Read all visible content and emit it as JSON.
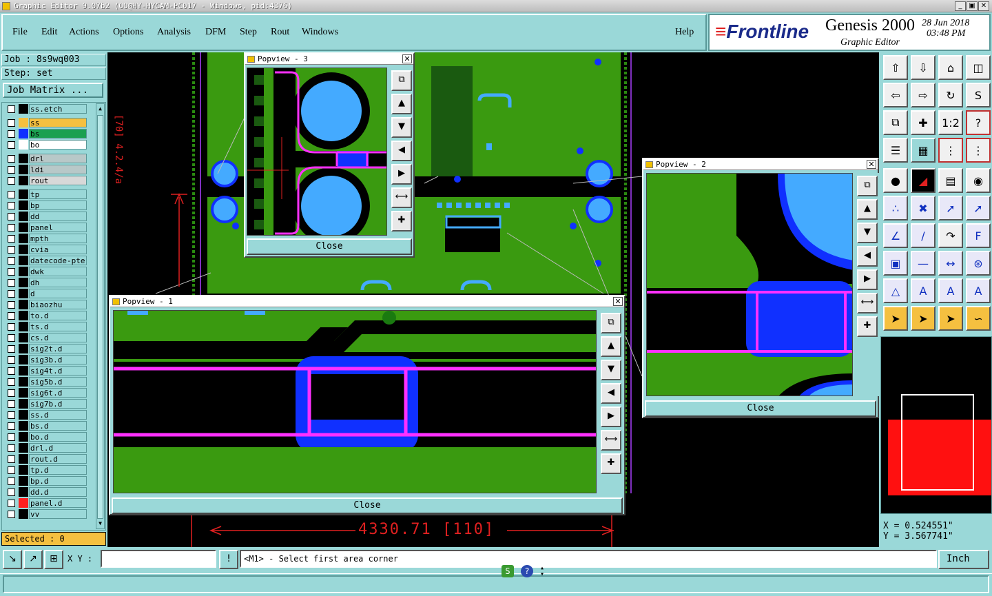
{
  "window": {
    "title": "Graphic Editor 9.07b2 (OO@HY-HYCAM-PC017 - Windows, pid:4376)",
    "min_label": "_",
    "max_label": "▣",
    "close_label": "✕"
  },
  "menu": {
    "items": [
      "File",
      "Edit",
      "Actions",
      "Options",
      "Analysis",
      "DFM",
      "Step",
      "Rout",
      "Windows"
    ],
    "help": "Help"
  },
  "brand": {
    "logo": "Frontline",
    "product": "Genesis 2000",
    "subtitle": "Graphic Editor",
    "date": "28 Jun 2018",
    "time": "03:48 PM"
  },
  "job": {
    "job_label": "Job : 8s9wq003",
    "step_label": "Step: set",
    "matrix_button": "Job Matrix ..."
  },
  "layers": [
    {
      "name": "ss.etch",
      "color": "#000000",
      "bg": "#9ad8d8"
    },
    {
      "name": "ss",
      "color": "#f5c040",
      "bg": "#f5c040"
    },
    {
      "name": "bs",
      "color": "#1030ff",
      "bg": "#1aa050"
    },
    {
      "name": "bo",
      "color": "#ffffff",
      "bg": "#ffffff"
    },
    {
      "name": "drl",
      "color": "#000000",
      "bg": "#b8c8c8"
    },
    {
      "name": "ldi",
      "color": "#000000",
      "bg": "#b8c8c8"
    },
    {
      "name": "rout",
      "color": "#000000",
      "bg": "#d8d8d8"
    },
    {
      "name": "tp",
      "color": "#000000",
      "bg": "#9ad8d8"
    },
    {
      "name": "bp",
      "color": "#000000",
      "bg": "#9ad8d8"
    },
    {
      "name": "dd",
      "color": "#000000",
      "bg": "#9ad8d8"
    },
    {
      "name": "panel",
      "color": "#000000",
      "bg": "#9ad8d8"
    },
    {
      "name": "mpth",
      "color": "#000000",
      "bg": "#9ad8d8"
    },
    {
      "name": "cvia",
      "color": "#000000",
      "bg": "#9ad8d8"
    },
    {
      "name": "datecode-pte",
      "color": "#000000",
      "bg": "#9ad8d8"
    },
    {
      "name": "dwk",
      "color": "#000000",
      "bg": "#9ad8d8"
    },
    {
      "name": "dh",
      "color": "#000000",
      "bg": "#9ad8d8"
    },
    {
      "name": "d",
      "color": "#000000",
      "bg": "#9ad8d8"
    },
    {
      "name": "biaozhu",
      "color": "#000000",
      "bg": "#9ad8d8"
    },
    {
      "name": "to.d",
      "color": "#000000",
      "bg": "#9ad8d8"
    },
    {
      "name": "ts.d",
      "color": "#000000",
      "bg": "#9ad8d8"
    },
    {
      "name": "cs.d",
      "color": "#000000",
      "bg": "#9ad8d8"
    },
    {
      "name": "sig2t.d",
      "color": "#000000",
      "bg": "#9ad8d8"
    },
    {
      "name": "sig3b.d",
      "color": "#000000",
      "bg": "#9ad8d8"
    },
    {
      "name": "sig4t.d",
      "color": "#000000",
      "bg": "#9ad8d8"
    },
    {
      "name": "sig5b.d",
      "color": "#000000",
      "bg": "#9ad8d8"
    },
    {
      "name": "sig6t.d",
      "color": "#000000",
      "bg": "#9ad8d8"
    },
    {
      "name": "sig7b.d",
      "color": "#000000",
      "bg": "#9ad8d8"
    },
    {
      "name": "ss.d",
      "color": "#000000",
      "bg": "#9ad8d8"
    },
    {
      "name": "bs.d",
      "color": "#000000",
      "bg": "#9ad8d8"
    },
    {
      "name": "bo.d",
      "color": "#000000",
      "bg": "#9ad8d8"
    },
    {
      "name": "drl.d",
      "color": "#000000",
      "bg": "#9ad8d8"
    },
    {
      "name": "rout.d",
      "color": "#000000",
      "bg": "#9ad8d8"
    },
    {
      "name": "tp.d",
      "color": "#000000",
      "bg": "#9ad8d8"
    },
    {
      "name": "bp.d",
      "color": "#000000",
      "bg": "#9ad8d8"
    },
    {
      "name": "dd.d",
      "color": "#000000",
      "bg": "#9ad8d8"
    },
    {
      "name": "panel.d",
      "color": "#ff2020",
      "bg": "#9ad8d8"
    },
    {
      "name": "vv",
      "color": "#000000",
      "bg": "#9ad8d8"
    }
  ],
  "selected_label": "Selected : 0",
  "canvas": {
    "dimension_label": "4330.71 [110]"
  },
  "popups": {
    "p3": {
      "title": "Popview - 3",
      "close": "Close"
    },
    "p2": {
      "title": "Popview - 2",
      "close": "Close"
    },
    "p1": {
      "title": "Popview - 1",
      "close": "Close"
    }
  },
  "coords": {
    "x": "X = 0.524551\"",
    "y": "Y = 3.567741\""
  },
  "command": {
    "xy_label": "X Y :",
    "xy_value": "",
    "prompt": "<M1> - Select first area corner",
    "unit": "Inch"
  },
  "colors": {
    "copper": "#3a9a10",
    "pad": "#44aaff",
    "blue": "#1030ff",
    "magenta": "#ff30ff",
    "highlight": "#f5c040"
  }
}
